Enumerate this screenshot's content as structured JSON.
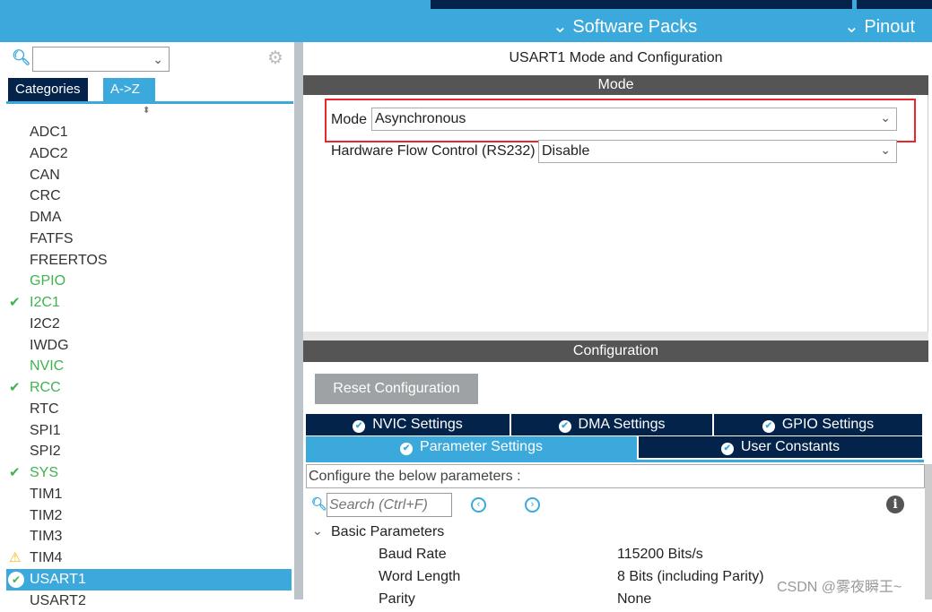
{
  "topbar": {
    "software_packs": "Software Packs",
    "pinout": "Pinout"
  },
  "left": {
    "tabs": [
      "Categories",
      "A->Z"
    ],
    "items": [
      {
        "label": "ADC1",
        "status": ""
      },
      {
        "label": "ADC2",
        "status": ""
      },
      {
        "label": "CAN",
        "status": ""
      },
      {
        "label": "CRC",
        "status": ""
      },
      {
        "label": "DMA",
        "status": ""
      },
      {
        "label": "FATFS",
        "status": ""
      },
      {
        "label": "FREERTOS",
        "status": ""
      },
      {
        "label": "GPIO",
        "status": "green"
      },
      {
        "label": "I2C1",
        "status": "check"
      },
      {
        "label": "I2C2",
        "status": ""
      },
      {
        "label": "IWDG",
        "status": ""
      },
      {
        "label": "NVIC",
        "status": "green"
      },
      {
        "label": "RCC",
        "status": "check"
      },
      {
        "label": "RTC",
        "status": ""
      },
      {
        "label": "SPI1",
        "status": ""
      },
      {
        "label": "SPI2",
        "status": ""
      },
      {
        "label": "SYS",
        "status": "check"
      },
      {
        "label": "TIM1",
        "status": ""
      },
      {
        "label": "TIM2",
        "status": ""
      },
      {
        "label": "TIM3",
        "status": ""
      },
      {
        "label": "TIM4",
        "status": "warning"
      },
      {
        "label": "USART1",
        "status": "selected"
      },
      {
        "label": "USART2",
        "status": ""
      }
    ]
  },
  "main": {
    "title": "USART1 Mode and Configuration",
    "mode_header": "Mode",
    "mode_label": "Mode",
    "mode_value": "Asynchronous",
    "hfc_label": "Hardware Flow Control (RS232)",
    "hfc_value": "Disable",
    "config_header": "Configuration",
    "reset_button": "Reset Configuration",
    "tabs": [
      "NVIC Settings",
      "DMA Settings",
      "GPIO Settings",
      "Parameter Settings",
      "User Constants"
    ],
    "configure_text": "Configure the below parameters :",
    "search_placeholder": "Search (Ctrl+F)",
    "group": "Basic Parameters",
    "params": [
      {
        "name": "Baud Rate",
        "value": "115200 Bits/s"
      },
      {
        "name": "Word Length",
        "value": "8 Bits (including Parity)"
      },
      {
        "name": "Parity",
        "value": "None"
      }
    ]
  },
  "watermark": "CSDN @雾夜瞬王~",
  "colors": {
    "accent": "#3ba9db",
    "dark": "#03234b",
    "highlight": "#e8262b",
    "green": "#3fb34f"
  }
}
